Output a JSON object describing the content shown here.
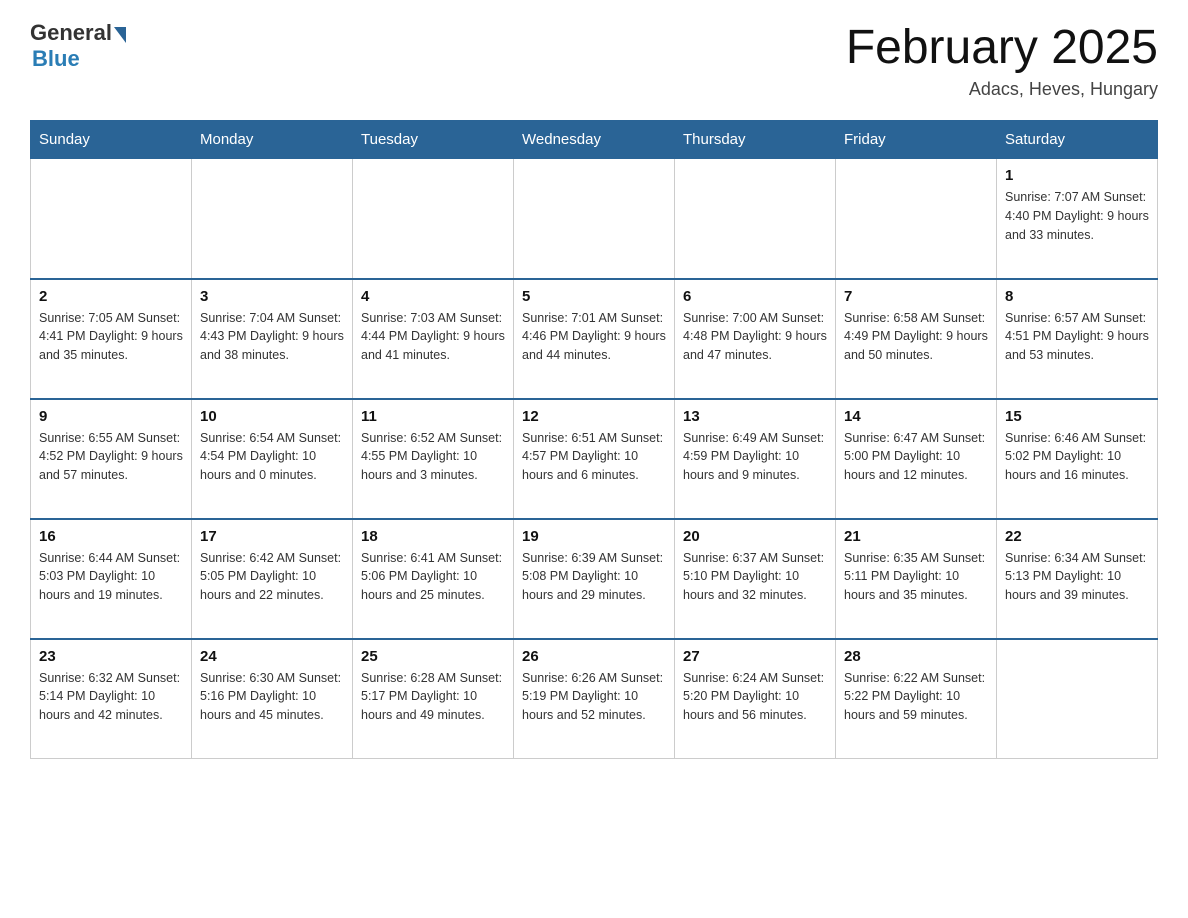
{
  "header": {
    "logo_general": "General",
    "logo_blue": "Blue",
    "month_title": "February 2025",
    "location": "Adacs, Heves, Hungary"
  },
  "weekdays": [
    "Sunday",
    "Monday",
    "Tuesday",
    "Wednesday",
    "Thursday",
    "Friday",
    "Saturday"
  ],
  "weeks": [
    [
      {
        "day": "",
        "info": ""
      },
      {
        "day": "",
        "info": ""
      },
      {
        "day": "",
        "info": ""
      },
      {
        "day": "",
        "info": ""
      },
      {
        "day": "",
        "info": ""
      },
      {
        "day": "",
        "info": ""
      },
      {
        "day": "1",
        "info": "Sunrise: 7:07 AM\nSunset: 4:40 PM\nDaylight: 9 hours and 33 minutes."
      }
    ],
    [
      {
        "day": "2",
        "info": "Sunrise: 7:05 AM\nSunset: 4:41 PM\nDaylight: 9 hours and 35 minutes."
      },
      {
        "day": "3",
        "info": "Sunrise: 7:04 AM\nSunset: 4:43 PM\nDaylight: 9 hours and 38 minutes."
      },
      {
        "day": "4",
        "info": "Sunrise: 7:03 AM\nSunset: 4:44 PM\nDaylight: 9 hours and 41 minutes."
      },
      {
        "day": "5",
        "info": "Sunrise: 7:01 AM\nSunset: 4:46 PM\nDaylight: 9 hours and 44 minutes."
      },
      {
        "day": "6",
        "info": "Sunrise: 7:00 AM\nSunset: 4:48 PM\nDaylight: 9 hours and 47 minutes."
      },
      {
        "day": "7",
        "info": "Sunrise: 6:58 AM\nSunset: 4:49 PM\nDaylight: 9 hours and 50 minutes."
      },
      {
        "day": "8",
        "info": "Sunrise: 6:57 AM\nSunset: 4:51 PM\nDaylight: 9 hours and 53 minutes."
      }
    ],
    [
      {
        "day": "9",
        "info": "Sunrise: 6:55 AM\nSunset: 4:52 PM\nDaylight: 9 hours and 57 minutes."
      },
      {
        "day": "10",
        "info": "Sunrise: 6:54 AM\nSunset: 4:54 PM\nDaylight: 10 hours and 0 minutes."
      },
      {
        "day": "11",
        "info": "Sunrise: 6:52 AM\nSunset: 4:55 PM\nDaylight: 10 hours and 3 minutes."
      },
      {
        "day": "12",
        "info": "Sunrise: 6:51 AM\nSunset: 4:57 PM\nDaylight: 10 hours and 6 minutes."
      },
      {
        "day": "13",
        "info": "Sunrise: 6:49 AM\nSunset: 4:59 PM\nDaylight: 10 hours and 9 minutes."
      },
      {
        "day": "14",
        "info": "Sunrise: 6:47 AM\nSunset: 5:00 PM\nDaylight: 10 hours and 12 minutes."
      },
      {
        "day": "15",
        "info": "Sunrise: 6:46 AM\nSunset: 5:02 PM\nDaylight: 10 hours and 16 minutes."
      }
    ],
    [
      {
        "day": "16",
        "info": "Sunrise: 6:44 AM\nSunset: 5:03 PM\nDaylight: 10 hours and 19 minutes."
      },
      {
        "day": "17",
        "info": "Sunrise: 6:42 AM\nSunset: 5:05 PM\nDaylight: 10 hours and 22 minutes."
      },
      {
        "day": "18",
        "info": "Sunrise: 6:41 AM\nSunset: 5:06 PM\nDaylight: 10 hours and 25 minutes."
      },
      {
        "day": "19",
        "info": "Sunrise: 6:39 AM\nSunset: 5:08 PM\nDaylight: 10 hours and 29 minutes."
      },
      {
        "day": "20",
        "info": "Sunrise: 6:37 AM\nSunset: 5:10 PM\nDaylight: 10 hours and 32 minutes."
      },
      {
        "day": "21",
        "info": "Sunrise: 6:35 AM\nSunset: 5:11 PM\nDaylight: 10 hours and 35 minutes."
      },
      {
        "day": "22",
        "info": "Sunrise: 6:34 AM\nSunset: 5:13 PM\nDaylight: 10 hours and 39 minutes."
      }
    ],
    [
      {
        "day": "23",
        "info": "Sunrise: 6:32 AM\nSunset: 5:14 PM\nDaylight: 10 hours and 42 minutes."
      },
      {
        "day": "24",
        "info": "Sunrise: 6:30 AM\nSunset: 5:16 PM\nDaylight: 10 hours and 45 minutes."
      },
      {
        "day": "25",
        "info": "Sunrise: 6:28 AM\nSunset: 5:17 PM\nDaylight: 10 hours and 49 minutes."
      },
      {
        "day": "26",
        "info": "Sunrise: 6:26 AM\nSunset: 5:19 PM\nDaylight: 10 hours and 52 minutes."
      },
      {
        "day": "27",
        "info": "Sunrise: 6:24 AM\nSunset: 5:20 PM\nDaylight: 10 hours and 56 minutes."
      },
      {
        "day": "28",
        "info": "Sunrise: 6:22 AM\nSunset: 5:22 PM\nDaylight: 10 hours and 59 minutes."
      },
      {
        "day": "",
        "info": ""
      }
    ]
  ]
}
